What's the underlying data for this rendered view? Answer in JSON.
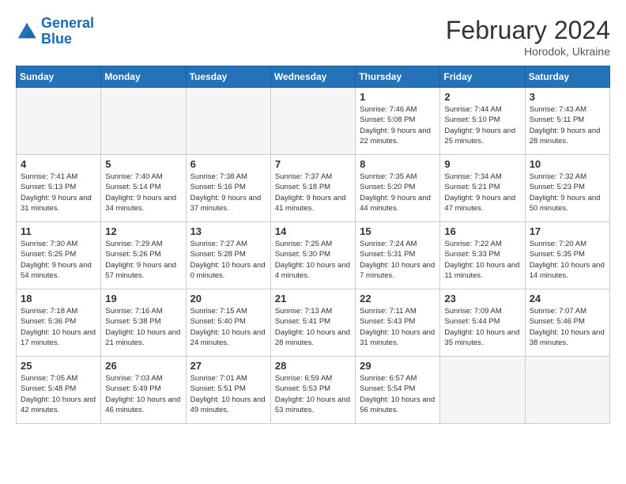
{
  "header": {
    "logo_line1": "General",
    "logo_line2": "Blue",
    "month_year": "February 2024",
    "location": "Horodok, Ukraine"
  },
  "days_of_week": [
    "Sunday",
    "Monday",
    "Tuesday",
    "Wednesday",
    "Thursday",
    "Friday",
    "Saturday"
  ],
  "weeks": [
    [
      {
        "day": "",
        "empty": true
      },
      {
        "day": "",
        "empty": true
      },
      {
        "day": "",
        "empty": true
      },
      {
        "day": "",
        "empty": true
      },
      {
        "day": "1",
        "sunrise": "7:46 AM",
        "sunset": "5:08 PM",
        "daylight": "9 hours and 22 minutes."
      },
      {
        "day": "2",
        "sunrise": "7:44 AM",
        "sunset": "5:10 PM",
        "daylight": "9 hours and 25 minutes."
      },
      {
        "day": "3",
        "sunrise": "7:43 AM",
        "sunset": "5:11 PM",
        "daylight": "9 hours and 28 minutes."
      }
    ],
    [
      {
        "day": "4",
        "sunrise": "7:41 AM",
        "sunset": "5:13 PM",
        "daylight": "9 hours and 31 minutes."
      },
      {
        "day": "5",
        "sunrise": "7:40 AM",
        "sunset": "5:14 PM",
        "daylight": "9 hours and 34 minutes."
      },
      {
        "day": "6",
        "sunrise": "7:38 AM",
        "sunset": "5:16 PM",
        "daylight": "9 hours and 37 minutes."
      },
      {
        "day": "7",
        "sunrise": "7:37 AM",
        "sunset": "5:18 PM",
        "daylight": "9 hours and 41 minutes."
      },
      {
        "day": "8",
        "sunrise": "7:35 AM",
        "sunset": "5:20 PM",
        "daylight": "9 hours and 44 minutes."
      },
      {
        "day": "9",
        "sunrise": "7:34 AM",
        "sunset": "5:21 PM",
        "daylight": "9 hours and 47 minutes."
      },
      {
        "day": "10",
        "sunrise": "7:32 AM",
        "sunset": "5:23 PM",
        "daylight": "9 hours and 50 minutes."
      }
    ],
    [
      {
        "day": "11",
        "sunrise": "7:30 AM",
        "sunset": "5:25 PM",
        "daylight": "9 hours and 54 minutes."
      },
      {
        "day": "12",
        "sunrise": "7:29 AM",
        "sunset": "5:26 PM",
        "daylight": "9 hours and 57 minutes."
      },
      {
        "day": "13",
        "sunrise": "7:27 AM",
        "sunset": "5:28 PM",
        "daylight": "10 hours and 0 minutes."
      },
      {
        "day": "14",
        "sunrise": "7:25 AM",
        "sunset": "5:30 PM",
        "daylight": "10 hours and 4 minutes."
      },
      {
        "day": "15",
        "sunrise": "7:24 AM",
        "sunset": "5:31 PM",
        "daylight": "10 hours and 7 minutes."
      },
      {
        "day": "16",
        "sunrise": "7:22 AM",
        "sunset": "5:33 PM",
        "daylight": "10 hours and 11 minutes."
      },
      {
        "day": "17",
        "sunrise": "7:20 AM",
        "sunset": "5:35 PM",
        "daylight": "10 hours and 14 minutes."
      }
    ],
    [
      {
        "day": "18",
        "sunrise": "7:18 AM",
        "sunset": "5:36 PM",
        "daylight": "10 hours and 17 minutes."
      },
      {
        "day": "19",
        "sunrise": "7:16 AM",
        "sunset": "5:38 PM",
        "daylight": "10 hours and 21 minutes."
      },
      {
        "day": "20",
        "sunrise": "7:15 AM",
        "sunset": "5:40 PM",
        "daylight": "10 hours and 24 minutes."
      },
      {
        "day": "21",
        "sunrise": "7:13 AM",
        "sunset": "5:41 PM",
        "daylight": "10 hours and 28 minutes."
      },
      {
        "day": "22",
        "sunrise": "7:11 AM",
        "sunset": "5:43 PM",
        "daylight": "10 hours and 31 minutes."
      },
      {
        "day": "23",
        "sunrise": "7:09 AM",
        "sunset": "5:44 PM",
        "daylight": "10 hours and 35 minutes."
      },
      {
        "day": "24",
        "sunrise": "7:07 AM",
        "sunset": "5:46 PM",
        "daylight": "10 hours and 38 minutes."
      }
    ],
    [
      {
        "day": "25",
        "sunrise": "7:05 AM",
        "sunset": "5:48 PM",
        "daylight": "10 hours and 42 minutes."
      },
      {
        "day": "26",
        "sunrise": "7:03 AM",
        "sunset": "5:49 PM",
        "daylight": "10 hours and 46 minutes."
      },
      {
        "day": "27",
        "sunrise": "7:01 AM",
        "sunset": "5:51 PM",
        "daylight": "10 hours and 49 minutes."
      },
      {
        "day": "28",
        "sunrise": "6:59 AM",
        "sunset": "5:53 PM",
        "daylight": "10 hours and 53 minutes."
      },
      {
        "day": "29",
        "sunrise": "6:57 AM",
        "sunset": "5:54 PM",
        "daylight": "10 hours and 56 minutes."
      },
      {
        "day": "",
        "empty": true
      },
      {
        "day": "",
        "empty": true
      }
    ]
  ]
}
